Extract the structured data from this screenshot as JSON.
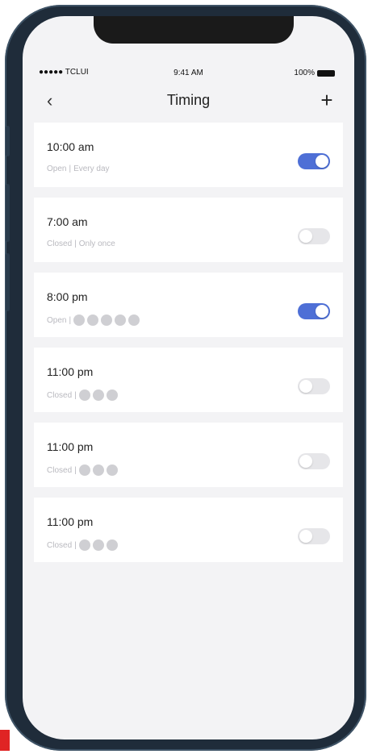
{
  "status_bar": {
    "carrier": "●●●●● TCLUI",
    "time": "9:41 AM",
    "battery": "100%"
  },
  "nav": {
    "back": "‹",
    "title": "Timing",
    "add": "+"
  },
  "colors": {
    "accent": "#4e6fd6",
    "toggle_off": "#e6e6e9"
  },
  "timers": [
    {
      "time": "10:00 am",
      "status": "Open",
      "repeat_text": "Every day",
      "days": [],
      "enabled": true
    },
    {
      "time": "7:00 am",
      "status": "Closed",
      "repeat_text": "Only once",
      "days": [],
      "enabled": false
    },
    {
      "time": "8:00 pm",
      "status": "Open",
      "repeat_text": "",
      "days": [
        "",
        "",
        "",
        "",
        ""
      ],
      "enabled": true
    },
    {
      "time": "11:00 pm",
      "status": "Closed",
      "repeat_text": "",
      "days": [
        "",
        "",
        ""
      ],
      "enabled": false
    },
    {
      "time": "11:00 pm",
      "status": "Closed",
      "repeat_text": "",
      "days": [
        "",
        "",
        ""
      ],
      "enabled": false
    },
    {
      "time": "11:00 pm",
      "status": "Closed",
      "repeat_text": "",
      "days": [
        "",
        "",
        ""
      ],
      "enabled": false
    }
  ]
}
